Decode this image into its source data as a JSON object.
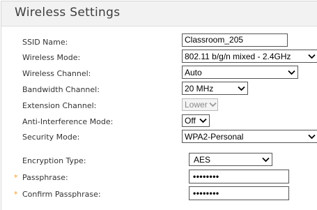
{
  "header": {
    "title": "Wireless Settings"
  },
  "fields": {
    "ssid": {
      "label": "SSID Name:",
      "value": "Classroom_205"
    },
    "wireless_mode": {
      "label": "Wireless Mode:",
      "value": "802.11 b/g/n mixed - 2.4GHz"
    },
    "wireless_channel": {
      "label": "Wireless Channel:",
      "value": "Auto"
    },
    "bandwidth_channel": {
      "label": "Bandwidth Channel:",
      "value": "20 MHz"
    },
    "extension_channel": {
      "label": "Extension Channel:",
      "value": "Lower"
    },
    "anti_interference": {
      "label": "Anti-Interference Mode:",
      "value": "Off"
    },
    "security_mode": {
      "label": "Security Mode:",
      "value": "WPA2-Personal"
    },
    "encryption_type": {
      "label": "Encryption Type:",
      "value": "AES"
    },
    "passphrase": {
      "label": "Passphrase:",
      "required_mark": "*",
      "value": "••••••••"
    },
    "confirm_passphrase": {
      "label": "Confirm Passphrase:",
      "required_mark": "*",
      "value": "••••••••"
    }
  },
  "icons": {
    "select_arrow": "chevron-down-icon"
  },
  "colors": {
    "required": "#f0a030",
    "header_bg": "#f2f2f2"
  }
}
